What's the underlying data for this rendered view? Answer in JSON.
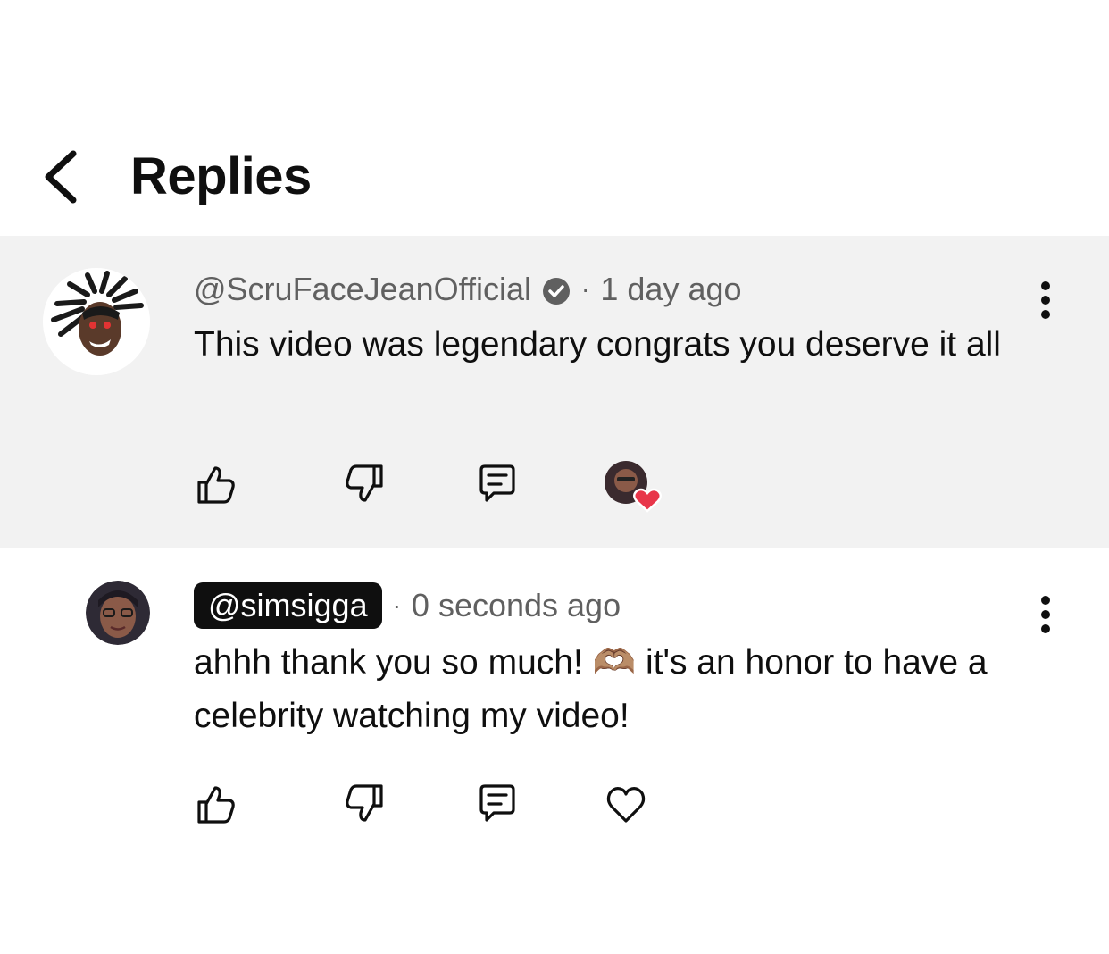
{
  "header": {
    "title": "Replies",
    "back_icon": "chevron-left-icon"
  },
  "comments": [
    {
      "author": "@ScruFaceJeanOfficial",
      "verified": true,
      "time": "1 day ago",
      "separator": "·",
      "text": "This video was legendary congrats you deserve it all",
      "hearted_by_creator": true,
      "highlighted": true
    },
    {
      "author": "@simsigga",
      "is_owner": true,
      "time": "0 seconds ago",
      "separator": "·",
      "text": "ahhh thank you so much! 🫶🏽 it's an honor to have a celebrity watching my video!",
      "hearted_by_creator": false
    }
  ],
  "icons": {
    "like": "thumbs-up-icon",
    "dislike": "thumbs-down-icon",
    "reply": "reply-icon",
    "heart": "heart-icon",
    "more": "more-vertical-icon",
    "verified": "verified-check-icon"
  },
  "colors": {
    "heart_red": "#e8364a",
    "highlight_bg": "#f2f2f2",
    "owner_chip_bg": "#0f0f0f"
  }
}
